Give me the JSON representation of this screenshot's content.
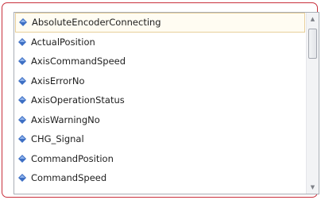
{
  "list": {
    "items": [
      {
        "label": "AbsoluteEncoderConnecting",
        "icon": "blue-diamond-icon",
        "selected": true
      },
      {
        "label": "ActualPosition",
        "icon": "blue-diamond-icon"
      },
      {
        "label": "AxisCommandSpeed",
        "icon": "blue-diamond-icon"
      },
      {
        "label": "AxisErrorNo",
        "icon": "blue-diamond-icon"
      },
      {
        "label": "AxisOperationStatus",
        "icon": "blue-diamond-icon"
      },
      {
        "label": "AxisWarningNo",
        "icon": "blue-diamond-icon"
      },
      {
        "label": "CHG_Signal",
        "icon": "blue-diamond-icon"
      },
      {
        "label": "CommandPosition",
        "icon": "blue-diamond-icon"
      },
      {
        "label": "CommandSpeed",
        "icon": "blue-diamond-icon"
      }
    ]
  },
  "scrollbar": {
    "up_glyph": "▲",
    "down_glyph": "▼"
  },
  "colors": {
    "frame_border": "#c8303c",
    "selected_background": "#fffcf2",
    "selected_border": "#e8cf9a",
    "icon_blue": "#3d6fc4"
  }
}
